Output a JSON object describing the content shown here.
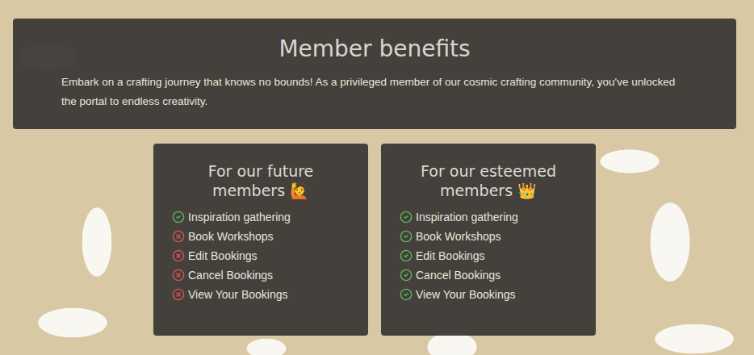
{
  "hero": {
    "title": "Member benefits",
    "description": "Embark on a crafting journey that knows no bounds! As a privileged member of our cosmic crafting community, you've unlocked the portal to endless creativity."
  },
  "cards": [
    {
      "title": "For our future members 🙋",
      "benefits": [
        {
          "label": "Inspiration gathering",
          "included": true
        },
        {
          "label": "Book Workshops",
          "included": false
        },
        {
          "label": "Edit Bookings",
          "included": false
        },
        {
          "label": "Cancel Bookings",
          "included": false
        },
        {
          "label": "View Your Bookings",
          "included": false
        }
      ]
    },
    {
      "title": "For our esteemed members 👑",
      "benefits": [
        {
          "label": "Inspiration gathering",
          "included": true
        },
        {
          "label": "Book Workshops",
          "included": true
        },
        {
          "label": "Edit Bookings",
          "included": true
        },
        {
          "label": "Cancel Bookings",
          "included": true
        },
        {
          "label": "View Your Bookings",
          "included": true
        }
      ]
    }
  ]
}
